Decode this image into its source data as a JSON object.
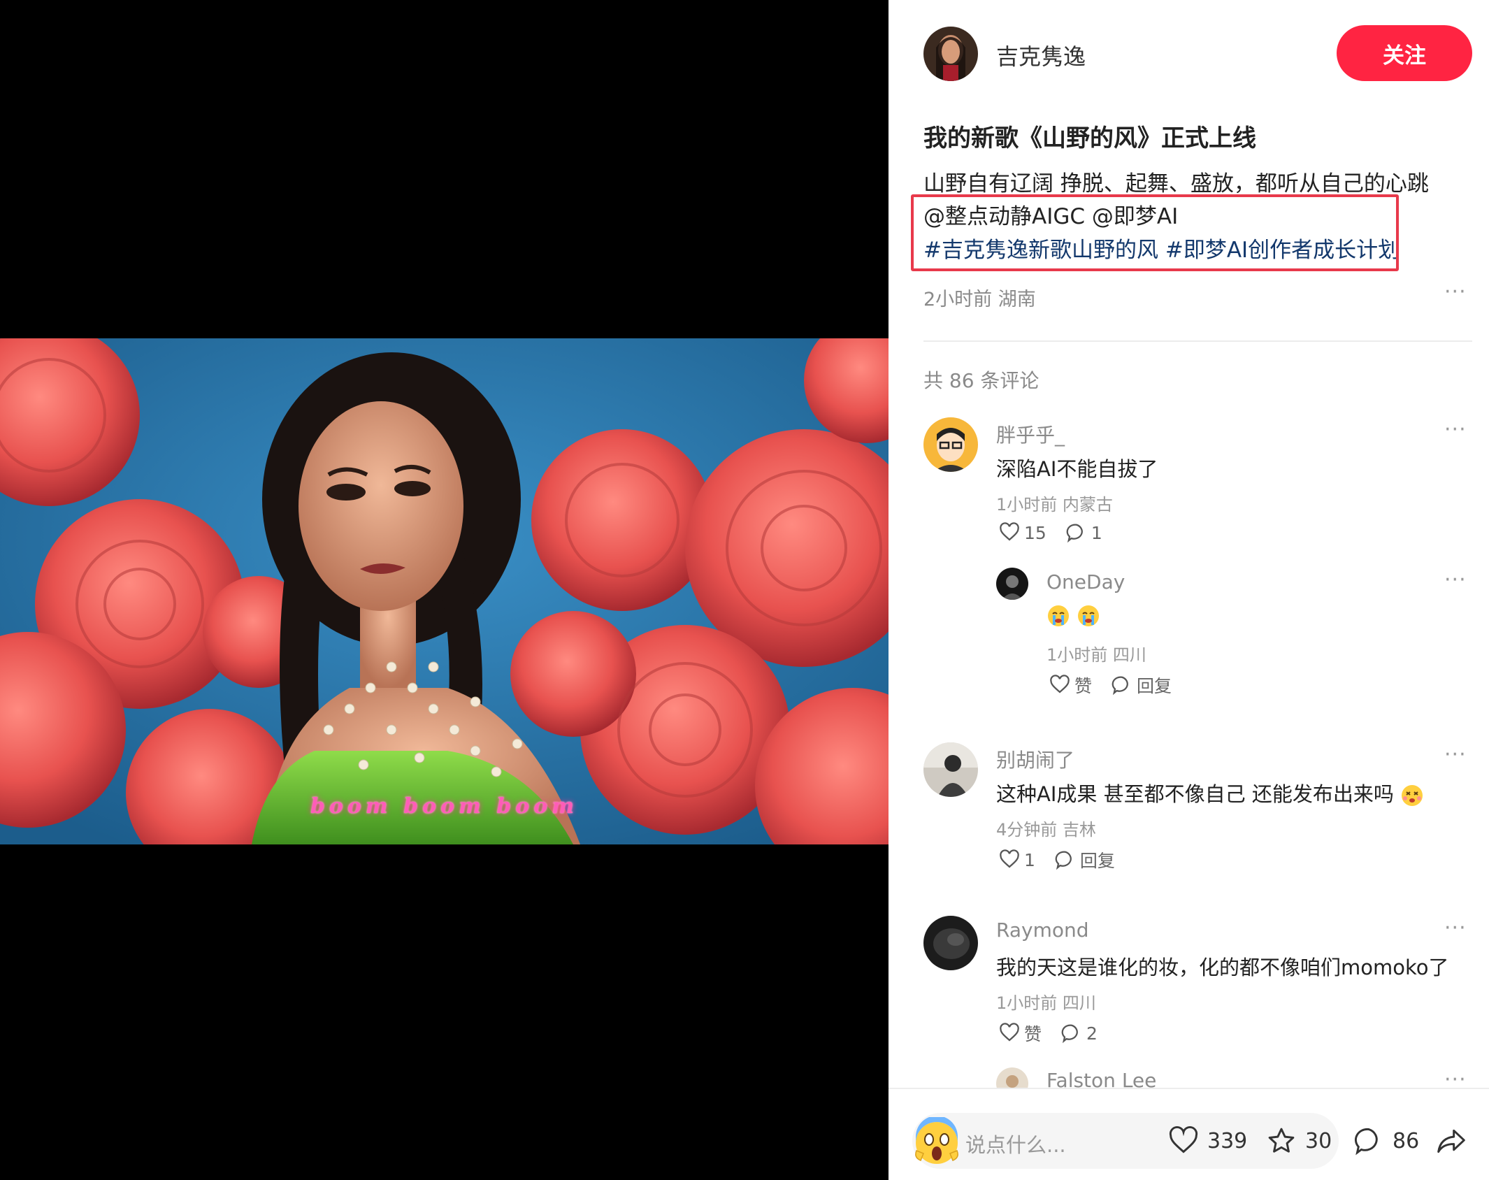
{
  "media": {
    "caption": "boom boom boom"
  },
  "author": {
    "name": "吉克隽逸",
    "follow_label": "关注"
  },
  "post": {
    "title": "我的新歌《山野的风》正式上线",
    "desc_line1": "山野自有辽阔 挣脱、起舞、盛放，都听从自己的心跳",
    "mentions": [
      "@整点动静AIGC",
      "@即梦AI"
    ],
    "tags": [
      "#吉克隽逸新歌山野的风",
      "#即梦AI创作者成长计划"
    ],
    "meta": "2小时前 湖南",
    "more": "···"
  },
  "comments_header": "共 86 条评论",
  "comments": [
    {
      "name": "胖乎乎_",
      "text": "深陷AI不能自拔了",
      "meta": "1小时前 内蒙古",
      "likes": "15",
      "replies": "1",
      "more": "···",
      "sub": {
        "name": "OneDay",
        "meta": "1小时前 四川",
        "like_label": "赞",
        "reply_label": "回复",
        "more": "···"
      }
    },
    {
      "name": "别胡闹了",
      "text": "这种AI成果 甚至都不像自己 还能发布出来吗",
      "meta": "4分钟前 吉林",
      "likes": "1",
      "reply_label": "回复",
      "more": "···"
    },
    {
      "name": "Raymond",
      "text": "我的天这是谁化的妆，化的都不像咱们momoko了",
      "meta": "1小时前 四川",
      "like_label": "赞",
      "replies": "2",
      "more": "···"
    },
    {
      "name": "Falston Lee",
      "more": "···"
    }
  ],
  "bottom_bar": {
    "placeholder": "说点什么...",
    "likes": "339",
    "stars": "30",
    "comments": "86"
  },
  "colors": {
    "accent": "#ff2442",
    "tag": "#13386c",
    "highlight_box": "#e8394b",
    "video_bg": "#2a7fb6",
    "roses": "#e8524f"
  }
}
